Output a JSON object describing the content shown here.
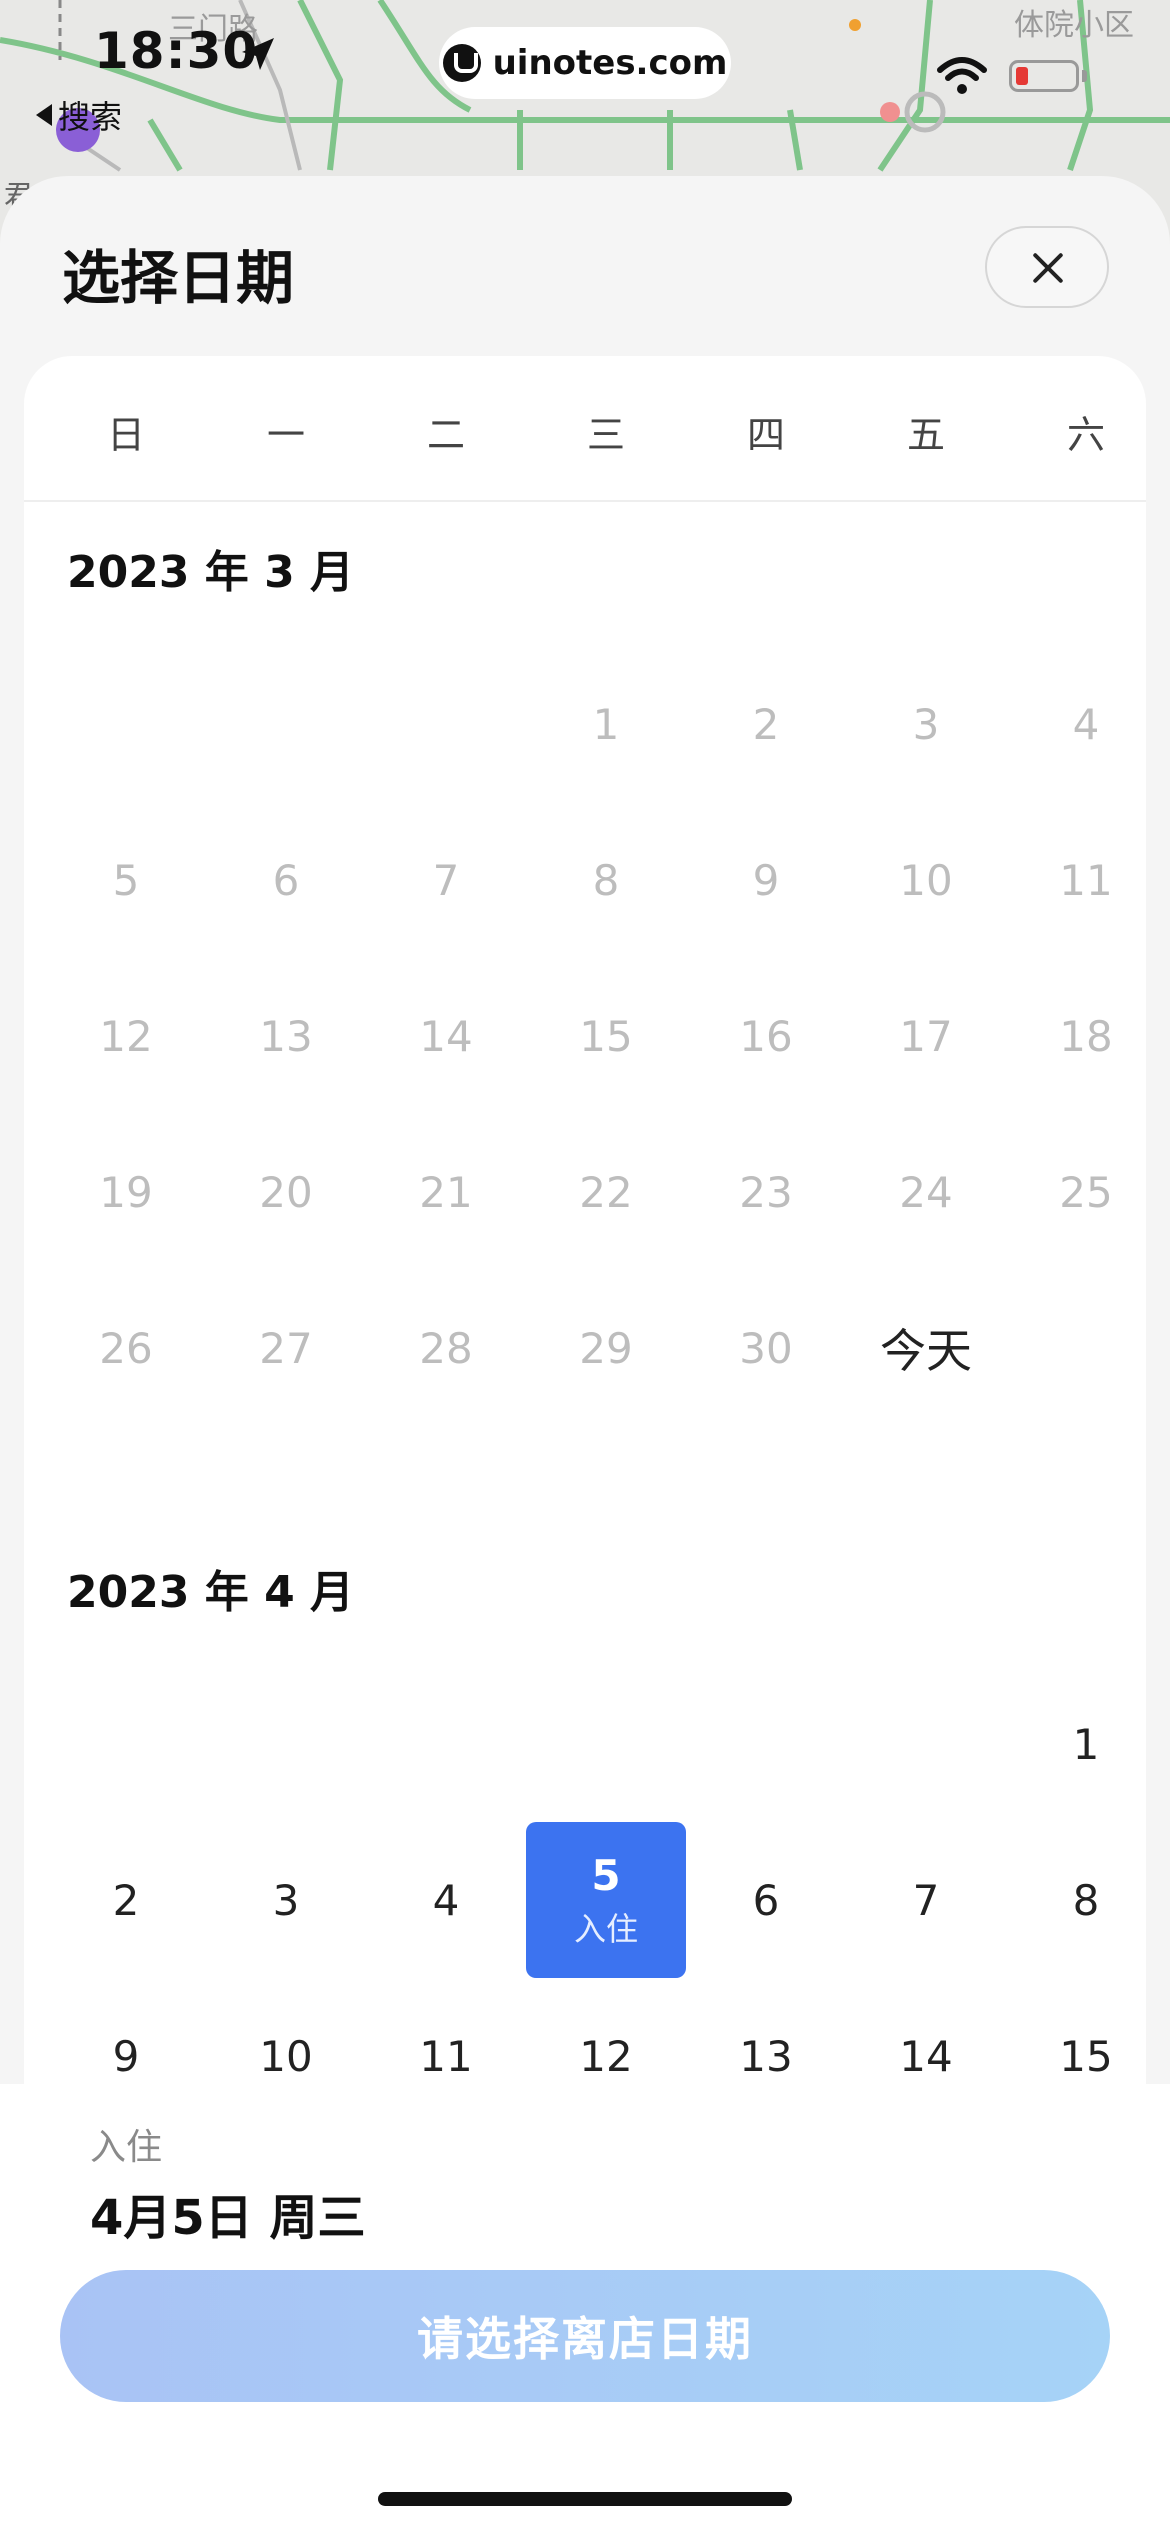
{
  "status_bar": {
    "time": "18:30",
    "back_label": "搜索",
    "site": "uinotes.com"
  },
  "map": {
    "road_label": "三门路",
    "area_label": "体院小区",
    "left_label": "君"
  },
  "sheet": {
    "title": "选择日期"
  },
  "weekdays": [
    "日",
    "一",
    "二",
    "三",
    "四",
    "五",
    "六"
  ],
  "months": [
    {
      "title": "2023 年 3 月",
      "first_col": 3,
      "days": [
        "1",
        "2",
        "3",
        "4",
        "5",
        "6",
        "7",
        "8",
        "9",
        "10",
        "11",
        "12",
        "13",
        "14",
        "15",
        "16",
        "17",
        "18",
        "19",
        "20",
        "21",
        "22",
        "23",
        "24",
        "25",
        "26",
        "27",
        "28",
        "29",
        "30",
        "今天"
      ],
      "past_until": 30
    },
    {
      "title": "2023 年 4 月",
      "first_col": 6,
      "days": [
        "1",
        "2",
        "3",
        "4",
        "5",
        "6",
        "7",
        "8",
        "9",
        "10",
        "11",
        "12",
        "13",
        "14",
        "15"
      ],
      "past_until": 0
    }
  ],
  "selection": {
    "selected_day": "5",
    "selected_tag": "入住"
  },
  "bottom": {
    "checkin_label": "入住",
    "checkin_date": "4月5日 周三",
    "cta_label": "请选择离店日期"
  },
  "colors": {
    "accent": "#3c73f0",
    "cta_gradient_start": "#a9c3f5",
    "cta_gradient_end": "#a6d3f7",
    "past_day": "#bdbdbd"
  }
}
